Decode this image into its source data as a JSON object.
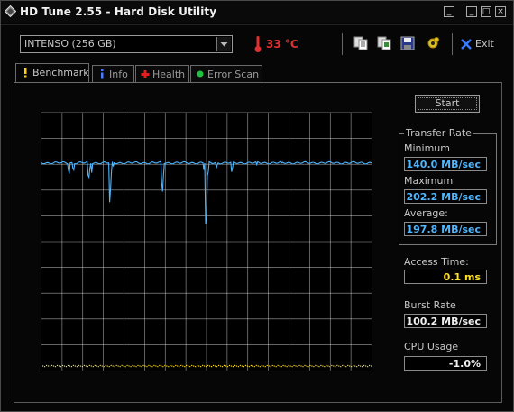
{
  "window": {
    "title": "HD Tune 2.55 - Hard Disk Utility",
    "controls": [
      "_",
      "□",
      "×"
    ]
  },
  "toolbar": {
    "drive": "INTENSO (256 GB)",
    "temperature": "33 °C",
    "exit_label": "Exit",
    "icons": [
      "copy-text-icon",
      "copy-screenshot-icon",
      "save-icon",
      "options-icon",
      "exit-icon"
    ]
  },
  "tabs": [
    {
      "label": "Benchmark",
      "icon": "exclamation-icon",
      "active": true
    },
    {
      "label": "Info",
      "icon": "info-icon",
      "active": false
    },
    {
      "label": "Health",
      "icon": "health-icon",
      "active": false
    },
    {
      "label": "Error Scan",
      "icon": "error-scan-icon",
      "active": false
    }
  ],
  "benchmark": {
    "start_label": "Start",
    "transfer_rate": {
      "title": "Transfer Rate",
      "minimum_label": "Minimum",
      "minimum": "140.0 MB/sec",
      "maximum_label": "Maximum",
      "maximum": "202.2 MB/sec",
      "average_label": "Average:",
      "average": "197.8 MB/sec"
    },
    "access_time_label": "Access Time:",
    "access_time": "0.1 ms",
    "burst_rate_label": "Burst Rate",
    "burst_rate": "100.2 MB/sec",
    "cpu_usage_label": "CPU Usage",
    "cpu_usage": "-1.0%"
  },
  "colors": {
    "transfer_line": "#4fb6ff",
    "access_points": "#ffe020",
    "temperature": "#e03030",
    "grid": "#d8d8d8"
  }
}
